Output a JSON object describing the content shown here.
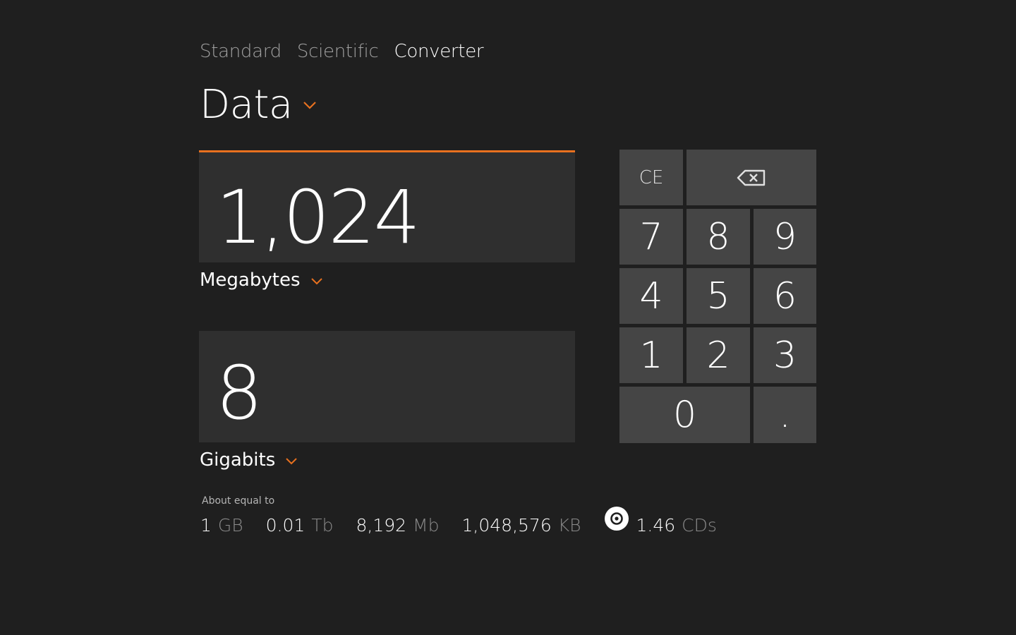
{
  "tabs": [
    {
      "label": "Standard",
      "active": false
    },
    {
      "label": "Scientific",
      "active": false
    },
    {
      "label": "Converter",
      "active": true
    }
  ],
  "category": {
    "label": "Data",
    "icon": "chevron-down-icon"
  },
  "from": {
    "value": "1,024",
    "unit": "Megabytes"
  },
  "to": {
    "value": "8",
    "unit": "Gigabits"
  },
  "about": {
    "label": "About equal to",
    "items": [
      {
        "num": "1",
        "unit": "GB"
      },
      {
        "num": "0.01",
        "unit": "Tb"
      },
      {
        "num": "8,192",
        "unit": "Mb"
      },
      {
        "num": "1,048,576",
        "unit": "KB"
      },
      {
        "num": "1.46",
        "unit": "CDs",
        "icon": "cd-icon"
      }
    ]
  },
  "keypad": {
    "ce": "CE",
    "backspace_icon": "backspace-icon",
    "digits": {
      "seven": "7",
      "eight": "8",
      "nine": "9",
      "four": "4",
      "five": "5",
      "six": "6",
      "one": "1",
      "two": "2",
      "three": "3",
      "zero": "0",
      "decimal": "."
    }
  },
  "colors": {
    "background": "#1f1f1f",
    "panel": "#2f2f2f",
    "key": "#454545",
    "accent": "#e8711f"
  }
}
